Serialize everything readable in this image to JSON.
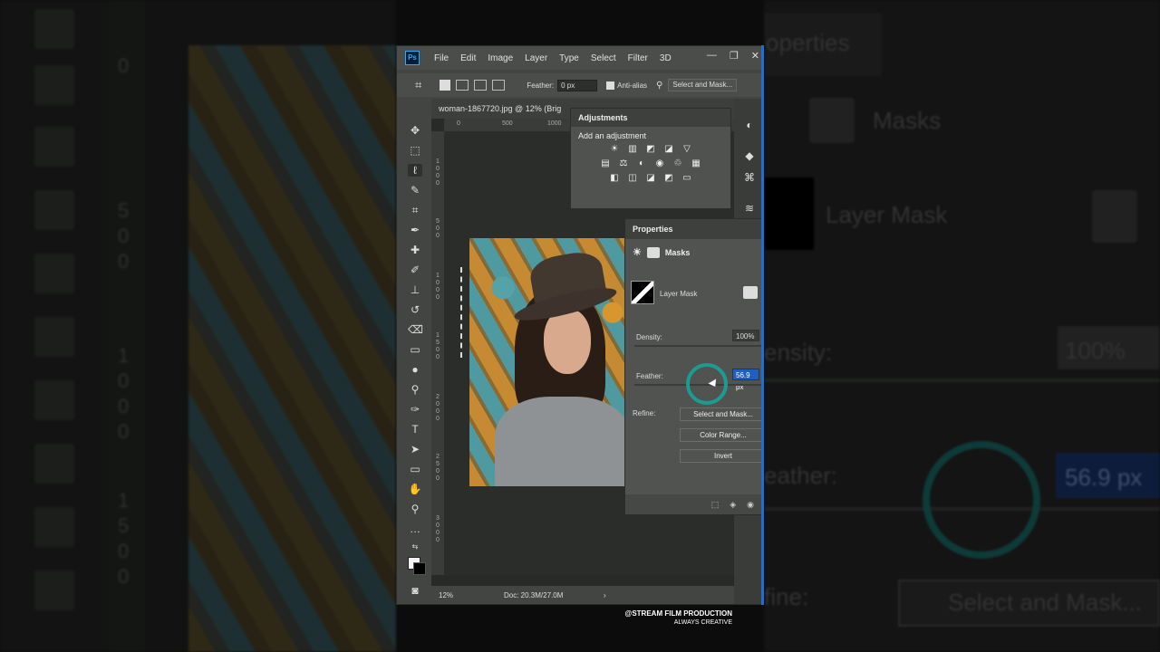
{
  "app": {
    "logo": "Ps",
    "menu": [
      "File",
      "Edit",
      "Image",
      "Layer",
      "Type",
      "Select",
      "Filter",
      "3D"
    ],
    "window_controls": [
      "—",
      "❐",
      "✕"
    ]
  },
  "options_bar": {
    "feather_label": "Feather:",
    "feather_value": "0 px",
    "anti_alias_label": "Anti-alias",
    "select_mask_button": "Select and Mask..."
  },
  "document": {
    "tab_title": "woman-1867720.jpg @ 12% (Brig",
    "h_ruler": [
      "0",
      "500",
      "1000"
    ],
    "v_ruler": [
      "1\n0\n0\n0",
      "5\n0\n0",
      "1\n0\n0\n0",
      "1\n5\n0\n0",
      "2\n0\n0\n0",
      "2\n5\n0\n0",
      "3\n0\n0\n0"
    ],
    "zoom": "12%",
    "doc_info": "Doc: 20.3M/27.0M"
  },
  "adjustments": {
    "title": "Adjustments",
    "subtitle": "Add an adjustment",
    "row1_icons": [
      "☀",
      "▥",
      "◩",
      "◪",
      "▽"
    ],
    "row2_icons": [
      "▤",
      "⚖",
      "◐",
      "◉",
      "♲",
      "▦"
    ],
    "row3_icons": [
      "◧",
      "◫",
      "◪",
      "◩",
      "▭"
    ]
  },
  "properties": {
    "title": "Properties",
    "masks_label": "Masks",
    "layer_mask_label": "Layer Mask",
    "density_label": "Density:",
    "density_value": "100%",
    "feather_label": "Feather:",
    "feather_value": "56.9 px",
    "refine_label": "Refine:",
    "buttons": [
      "Select and Mask...",
      "Color Range...",
      "Invert"
    ]
  },
  "background_zoom": {
    "masks": "Masks",
    "layer_mask": "Layer Mask",
    "density": "ensity:",
    "density_value": "100%",
    "feather": "eather:",
    "feather_value": "56.9 px",
    "refine": "fine:",
    "select_mask": "Select and Mask...",
    "properties_tab": "operties",
    "left_ruler": [
      "0",
      "5",
      "0",
      "0",
      "1",
      "0",
      "0",
      "0",
      "1",
      "5",
      "0",
      "0"
    ]
  },
  "watermark": {
    "line1": "@STREAM FILM PRODUCTION",
    "line2": "ALWAYS CREATIVE"
  }
}
